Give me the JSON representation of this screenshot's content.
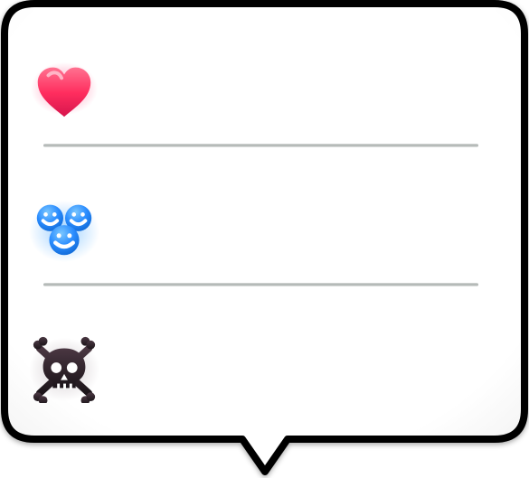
{
  "popup": {
    "items": [
      {
        "icon": "heart-icon",
        "label": ""
      },
      {
        "icon": "people-icon",
        "label": ""
      },
      {
        "icon": "skull-icon",
        "label": ""
      }
    ]
  },
  "colors": {
    "border": "#000000",
    "background": "#ffffff",
    "divider": "#b8bcbb",
    "heart": "#ff2f62",
    "people": "#2a8cff",
    "skull": "#2b2028"
  }
}
